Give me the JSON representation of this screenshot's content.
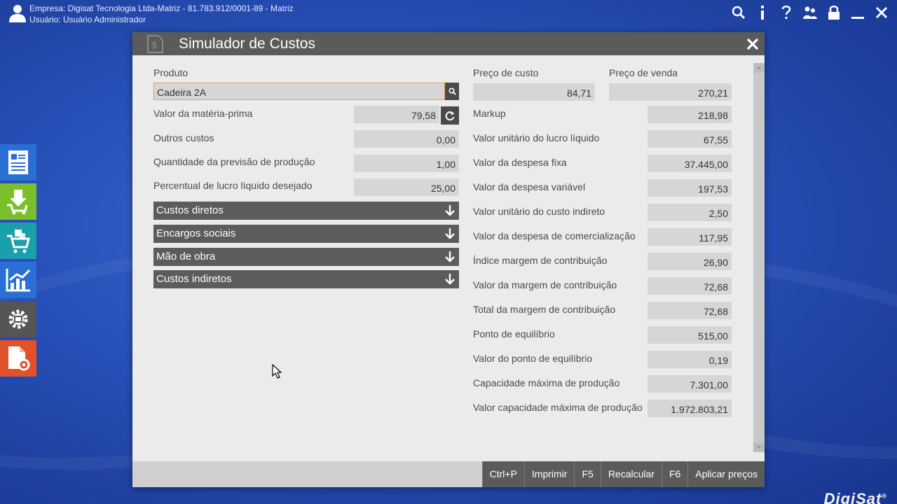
{
  "topbar": {
    "company_line": "Empresa:  Digisat Tecnologia Ltda-Matriz - 81.783.912/0001-89 - Matriz",
    "user_line": "Usuário:  Usuário Administrador"
  },
  "window": {
    "title": "Simulador de Custos"
  },
  "left": {
    "produto_label": "Produto",
    "produto_value": "Cadeira 2A",
    "fields": [
      {
        "label": "Valor da matéria-prima",
        "value": "79,58"
      },
      {
        "label": "Outros custos",
        "value": "0,00"
      },
      {
        "label": "Quantidade da previsão de produção",
        "value": "1,00"
      },
      {
        "label": "Percentual de lucro líquido desejado",
        "value": "25,00"
      }
    ],
    "sections": [
      "Custos diretos",
      "Encargos sociais",
      "Mão de obra",
      "Custos indiretos"
    ]
  },
  "right": {
    "preco_custo_label": "Preço de custo",
    "preco_custo_value": "84,71",
    "preco_venda_label": "Preço de venda",
    "preco_venda_value": "270,21",
    "fields": [
      {
        "label": "Markup",
        "value": "218,98"
      },
      {
        "label": "Valor unitário do lucro líquido",
        "value": "67,55"
      },
      {
        "label": "Valor da despesa fixa",
        "value": "37.445,00"
      },
      {
        "label": "Valor da despesa variável",
        "value": "197,53"
      },
      {
        "label": "Valor unitário do custo indireto",
        "value": "2,50"
      },
      {
        "label": "Valor da despesa de comercialização",
        "value": "117,95"
      },
      {
        "label": "Índice margem de contribuição",
        "value": "26,90"
      },
      {
        "label": "Valor da margem de contribuição",
        "value": "72,68"
      },
      {
        "label": "Total da margem de contribuição",
        "value": "72,68"
      },
      {
        "label": "Ponto de equilíbrio",
        "value": "515,00"
      },
      {
        "label": "Valor do ponto de equilíbrio",
        "value": "0,19"
      },
      {
        "label": "Capacidade máxima de produção",
        "value": "7.301,00"
      },
      {
        "label": "Valor capacidade máxima de produção",
        "value": "1.972.803,21"
      }
    ]
  },
  "footer": {
    "print_key": "Ctrl+P",
    "print_label": "Imprimir",
    "recalc_key": "F5",
    "recalc_label": "Recalcular",
    "apply_key": "F6",
    "apply_label": "Aplicar preços"
  },
  "brand": "DigiSat",
  "colors": {
    "accent_orange": "#e8a052",
    "panel_dark": "#5b5b5b",
    "tile_blue": "#2a6fd6",
    "tile_green": "#7bbf2a",
    "tile_teal": "#1aa0a8",
    "tile_gray": "#555555",
    "tile_orange": "#e0522a"
  },
  "icons": {
    "top": [
      "search-icon",
      "info-icon",
      "help-icon",
      "users-icon",
      "lock-icon",
      "minimize-icon",
      "close-icon"
    ],
    "side": [
      "document-icon",
      "download-icon",
      "cart-icon",
      "chart-icon",
      "settings-gear-icon",
      "file-settings-icon"
    ]
  }
}
